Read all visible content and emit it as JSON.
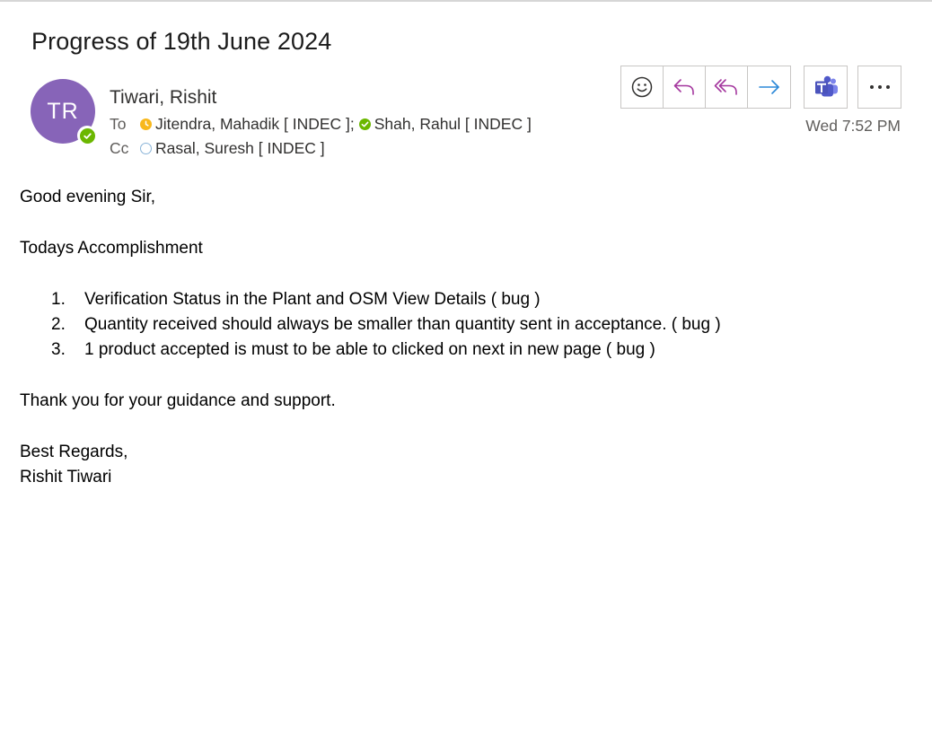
{
  "email": {
    "subject": "Progress of 19th June 2024",
    "sender": {
      "initials": "TR",
      "name": "Tiwari, Rishit",
      "avatar_color": "#8764b8",
      "presence": "available"
    },
    "to_label": "To",
    "cc_label": "Cc",
    "to": [
      {
        "name": "Jitendra, Mahadik [ INDEC ];",
        "presence": "away"
      },
      {
        "name": "Shah, Rahul [ INDEC ]",
        "presence": "available"
      }
    ],
    "cc": [
      {
        "name": "Rasal, Suresh [ INDEC ]",
        "presence": "offline"
      }
    ],
    "timestamp": "Wed 7:52 PM"
  },
  "toolbar": {
    "buttons": [
      {
        "icon": "emoji-react-icon"
      },
      {
        "icon": "reply-icon"
      },
      {
        "icon": "reply-all-icon"
      },
      {
        "icon": "forward-icon"
      },
      {
        "icon": "teams-icon"
      },
      {
        "icon": "more-options-icon"
      }
    ]
  },
  "body": {
    "greeting": "Good evening Sir,",
    "heading": "Todays Accomplishment",
    "items": [
      {
        "num": "1.",
        "text": "Verification Status in the Plant and OSM View Details ( bug )"
      },
      {
        "num": "2.",
        "text": "Quantity received should always be smaller than quantity sent in acceptance. ( bug )"
      },
      {
        "num": "3.",
        "text": "1 product accepted is must to be able to clicked on next in new page ( bug )"
      }
    ],
    "thanks": "Thank you for your guidance and support.",
    "closing": "Best Regards,",
    "signature": "Rishit Tiwari"
  },
  "colors": {
    "accent_purple": "#8764b8",
    "reply_icon": "#a4379e",
    "forward_icon": "#2b88d8",
    "available": "#6bb700",
    "away": "#f8b81c"
  }
}
